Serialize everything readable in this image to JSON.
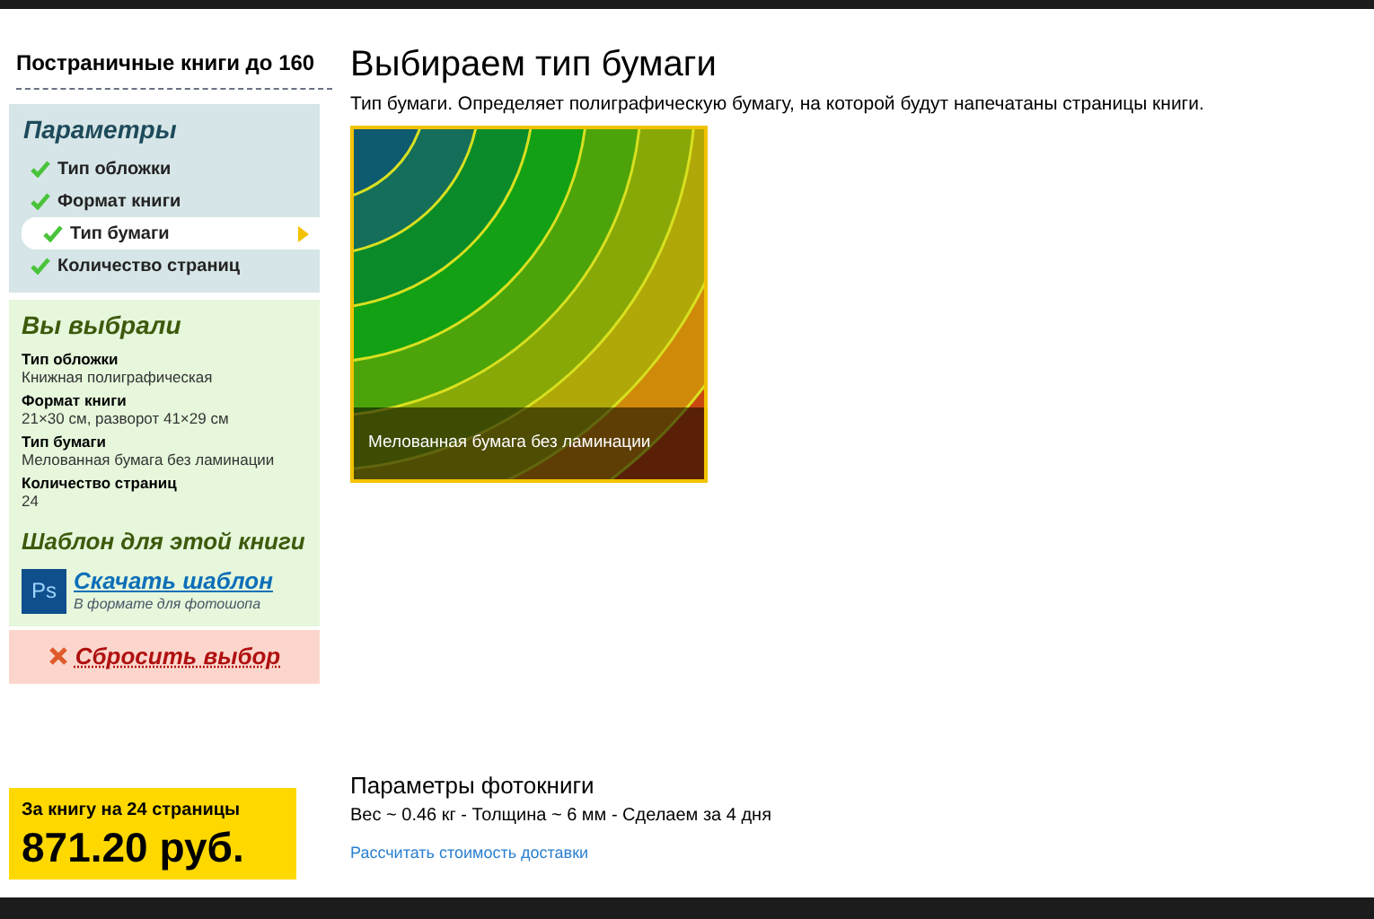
{
  "sidebar": {
    "book_title": "Постраничные книги до 160",
    "parameters": {
      "heading": "Параметры",
      "items": [
        {
          "label": "Тип обложки",
          "done": true,
          "selected": false
        },
        {
          "label": "Формат книги",
          "done": true,
          "selected": false
        },
        {
          "label": "Тип бумаги",
          "done": true,
          "selected": true
        },
        {
          "label": "Количество страниц",
          "done": true,
          "selected": false
        }
      ]
    },
    "chosen": {
      "heading": "Вы выбрали",
      "items": [
        {
          "name": "Тип обложки",
          "value": "Книжная полиграфическая"
        },
        {
          "name": "Формат книги",
          "value": "21×30 см, разворот 41×29 см"
        },
        {
          "name": "Тип бумаги",
          "value": "Мелованная бумага без ламинации"
        },
        {
          "name": "Количество страниц",
          "value": "24"
        }
      ]
    },
    "template": {
      "heading": "Шаблон для этой книги",
      "icon_text": "Ps",
      "link": "Скачать шаблон",
      "note": "В формате для фотошопа"
    },
    "reset": "Сбросить выбор"
  },
  "main": {
    "title": "Выбираем тип бумаги",
    "description": "Тип бумаги. Определяет полиграфическую бумагу, на которой будут напечатаны страницы книги.",
    "options": [
      {
        "caption": "Мелованная бумага без ламинации",
        "selected": true
      }
    ]
  },
  "footer": {
    "price_label": "За книгу на 24 страницы",
    "price": "871.20 руб.",
    "params_title": "Параметры фотокниги",
    "params": "Вес ~ 0.46 кг - Толщина ~ 6 мм - Сделаем за 4 дня",
    "delivery_link": "Рассчитать стоимость доставки"
  }
}
